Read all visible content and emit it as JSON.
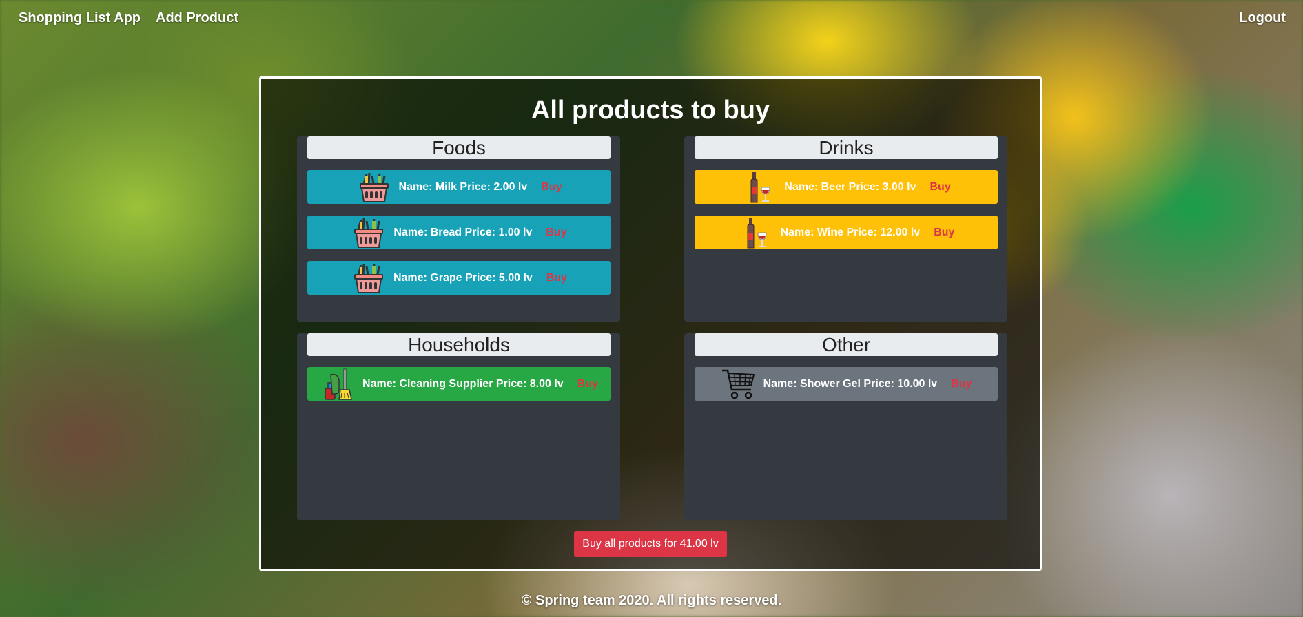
{
  "nav": {
    "brand": "Shopping List App",
    "add_product": "Add Product",
    "logout": "Logout"
  },
  "main": {
    "title": "All products to buy",
    "categories": [
      {
        "name": "Foods",
        "icon": "grocery-basket-icon",
        "color": "#17a2b8",
        "items": [
          {
            "text": "Name: Milk Price: 2.00 lv",
            "buy": "Buy"
          },
          {
            "text": "Name: Bread Price: 1.00 lv",
            "buy": "Buy"
          },
          {
            "text": "Name: Grape Price: 5.00 lv",
            "buy": "Buy"
          }
        ]
      },
      {
        "name": "Drinks",
        "icon": "wine-bottle-icon",
        "color": "#ffc107",
        "items": [
          {
            "text": "Name: Beer Price: 3.00 lv",
            "buy": "Buy"
          },
          {
            "text": "Name: Wine Price: 12.00 lv",
            "buy": "Buy"
          }
        ]
      },
      {
        "name": "Households",
        "icon": "cleaning-supplies-icon",
        "color": "#28a745",
        "items": [
          {
            "text": "Name: Cleaning Supplier Price: 8.00 lv",
            "buy": "Buy"
          }
        ]
      },
      {
        "name": "Other",
        "icon": "shopping-cart-icon",
        "color": "#6c757d",
        "items": [
          {
            "text": "Name: Shower Gel Price: 10.00 lv",
            "buy": "Buy"
          }
        ]
      }
    ],
    "buy_all": "Buy all products for 41.00 lv"
  },
  "footer": {
    "text": "© Spring team 2020. All rights reserved."
  },
  "colors": {
    "buy_text": "#dc3545",
    "header_bg": "#e9ecef",
    "card_bg": "#343a40"
  }
}
